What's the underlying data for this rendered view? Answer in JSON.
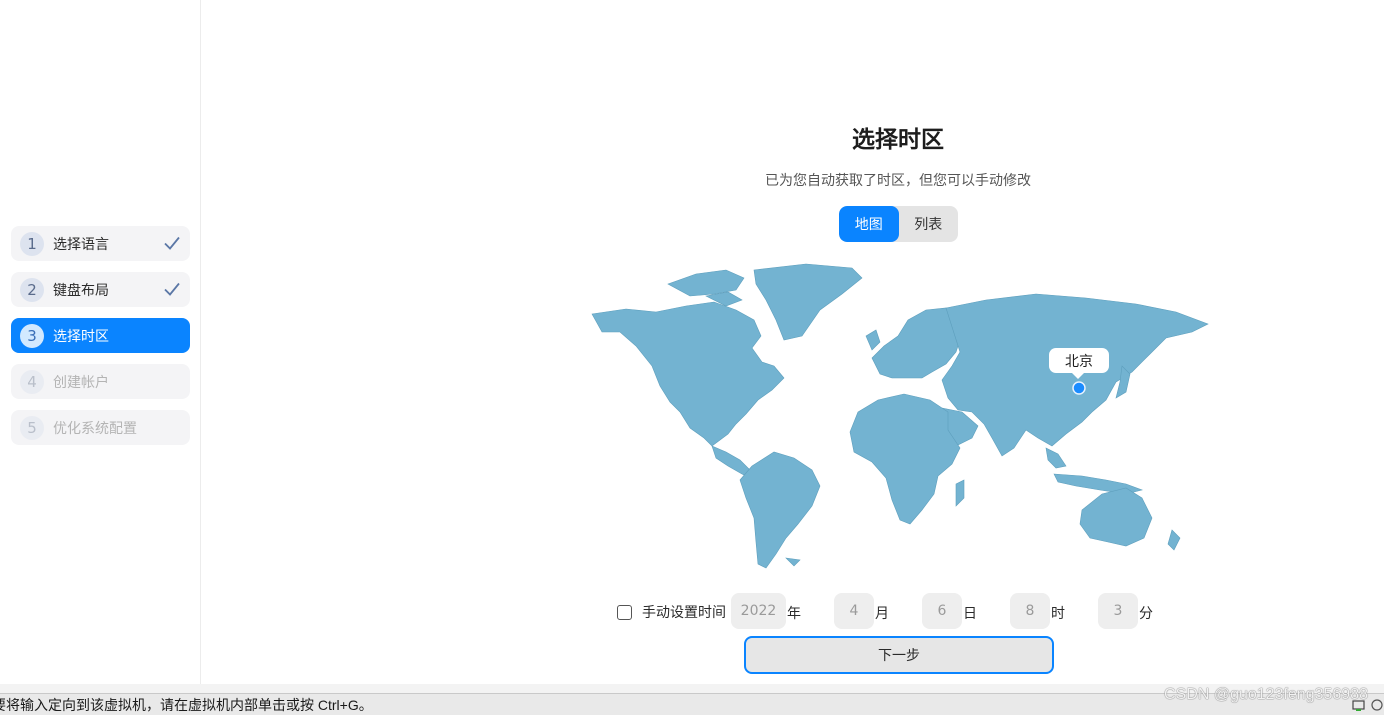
{
  "sidebar": {
    "steps": [
      {
        "num": "1",
        "label": "选择语言",
        "state": "done"
      },
      {
        "num": "2",
        "label": "键盘布局",
        "state": "done"
      },
      {
        "num": "3",
        "label": "选择时区",
        "state": "active"
      },
      {
        "num": "4",
        "label": "创建帐户",
        "state": "disabled"
      },
      {
        "num": "5",
        "label": "优化系统配置",
        "state": "disabled"
      }
    ]
  },
  "main": {
    "title": "选择时区",
    "subtitle": "已为您自动获取了时区，但您可以手动修改",
    "view_toggle": {
      "map_label": "地图",
      "list_label": "列表",
      "selected": "地图"
    },
    "map": {
      "selected_city": "北京",
      "land_color": "#73b3d1",
      "marker_color": "#1b8cff"
    },
    "manual_time": {
      "checkbox_label": "手动设置时间",
      "checked": false,
      "year": "2022",
      "year_unit": "年",
      "month": "4",
      "month_unit": "月",
      "day": "6",
      "day_unit": "日",
      "hour": "8",
      "hour_unit": "时",
      "minute": "3",
      "minute_unit": "分"
    },
    "next_label": "下一步"
  },
  "statusbar": {
    "message": "要将输入定向到该虚拟机，请在虚拟机内部单击或按 Ctrl+G。",
    "watermark": "CSDN @guo123feng356988"
  },
  "colors": {
    "accent": "#0a84ff",
    "map_land": "#73b3d1"
  }
}
